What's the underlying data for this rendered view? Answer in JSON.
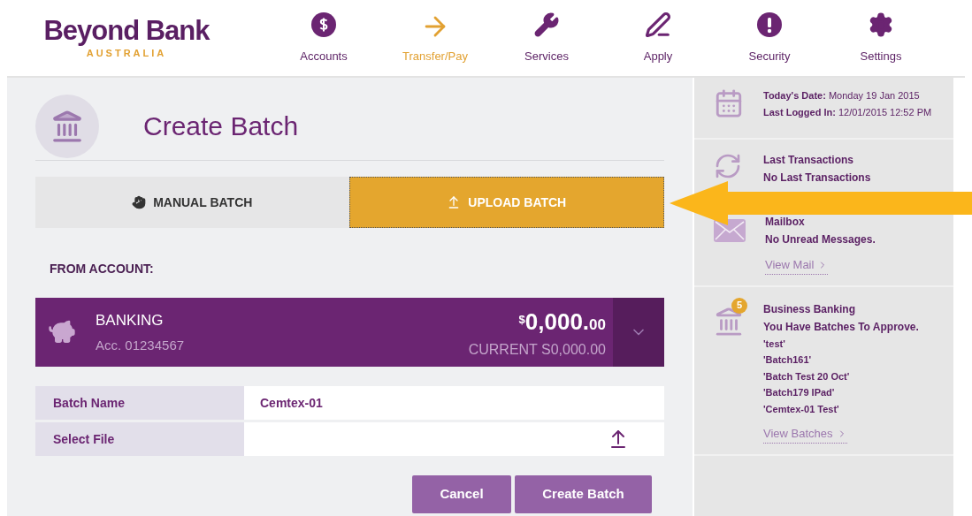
{
  "logo": {
    "name": "Beyond Bank",
    "region": "AUSTRALIA"
  },
  "nav": [
    {
      "label": "Accounts",
      "selected": false
    },
    {
      "label": "Transfer/Pay",
      "selected": true
    },
    {
      "label": "Services",
      "selected": false
    },
    {
      "label": "Apply",
      "selected": false
    },
    {
      "label": "Security",
      "selected": false
    },
    {
      "label": "Settings",
      "selected": false
    }
  ],
  "page": {
    "title": "Create Batch"
  },
  "tabs": [
    {
      "label": "MANUAL BATCH",
      "selected": false
    },
    {
      "label": "UPLOAD BATCH",
      "selected": true
    }
  ],
  "from_account": {
    "label": "FROM ACCOUNT:",
    "name": "BANKING",
    "number": "Acc. 01234567",
    "balance": {
      "symbol": "$",
      "whole": "0,000.",
      "cents": "00"
    },
    "current": "CURRENT S0,000.00"
  },
  "fields": [
    {
      "label": "Batch Name",
      "value": "Cemtex-01",
      "kind": "text"
    },
    {
      "label": "Select File",
      "kind": "file"
    }
  ],
  "buttons": [
    {
      "label": "Cancel"
    },
    {
      "label": "Create Batch"
    }
  ],
  "sidebar": {
    "date": [
      "**Today's Date:** Monday 19 Jan 2015",
      "**Last Logged In:** 12/01/2015 12:52 PM"
    ],
    "transactions": {
      "title": "Last Transactions",
      "text": "No Last Transactions"
    },
    "mailbox": {
      "title": "Mailbox",
      "text": "No Unread Messages.",
      "link": "View Mail"
    },
    "business": {
      "badge": "5",
      "title": "Business Banking",
      "text": "You Have Batches To Approve.",
      "batches": [
        "'test'",
        "'Batch161'",
        "'Batch Test 20 Oct'",
        "'Batch179 IPad'",
        "'Cemtex-01 Test'"
      ],
      "link": "View Batches"
    }
  }
}
